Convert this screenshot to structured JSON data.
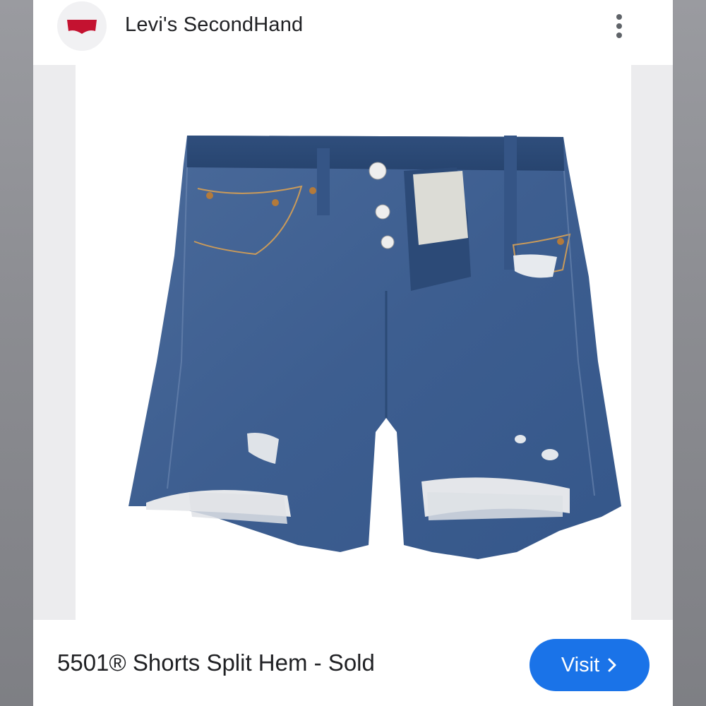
{
  "header": {
    "site_name": "Levi's SecondHand",
    "logo_icon": "levis-batwing-logo-icon",
    "menu_icon": "more-vert-icon"
  },
  "product": {
    "image_alt": "5501 Shorts Split Hem - denim shorts product photo",
    "title": "5501® Shorts Split Hem - Sold"
  },
  "actions": {
    "visit_label": "Visit",
    "visit_icon": "chevron-right-icon"
  },
  "colors": {
    "brand_red": "#c41230",
    "accent_blue": "#1a73e8",
    "denim": "#3f5f8f"
  }
}
